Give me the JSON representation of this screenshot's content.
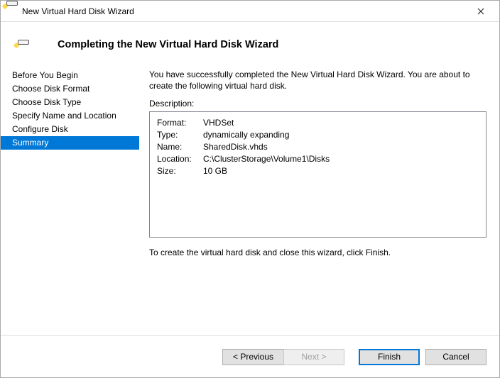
{
  "window": {
    "title": "New Virtual Hard Disk Wizard"
  },
  "header": {
    "title": "Completing the New Virtual Hard Disk Wizard"
  },
  "sidebar": {
    "items": [
      {
        "label": "Before You Begin"
      },
      {
        "label": "Choose Disk Format"
      },
      {
        "label": "Choose Disk Type"
      },
      {
        "label": "Specify Name and Location"
      },
      {
        "label": "Configure Disk"
      },
      {
        "label": "Summary"
      }
    ],
    "selected_index": 5
  },
  "content": {
    "intro": "You have successfully completed the New Virtual Hard Disk Wizard. You are about to create the following virtual hard disk.",
    "description_label": "Description:",
    "properties": {
      "format_label": "Format:",
      "format_value": "VHDSet",
      "type_label": "Type:",
      "type_value": "dynamically expanding",
      "name_label": "Name:",
      "name_value": "SharedDisk.vhds",
      "location_label": "Location:",
      "location_value": "C:\\ClusterStorage\\Volume1\\Disks",
      "size_label": "Size:",
      "size_value": "10 GB"
    },
    "outro": "To create the virtual hard disk and close this wizard, click Finish."
  },
  "footer": {
    "previous": "< Previous",
    "next": "Next >",
    "finish": "Finish",
    "cancel": "Cancel"
  }
}
